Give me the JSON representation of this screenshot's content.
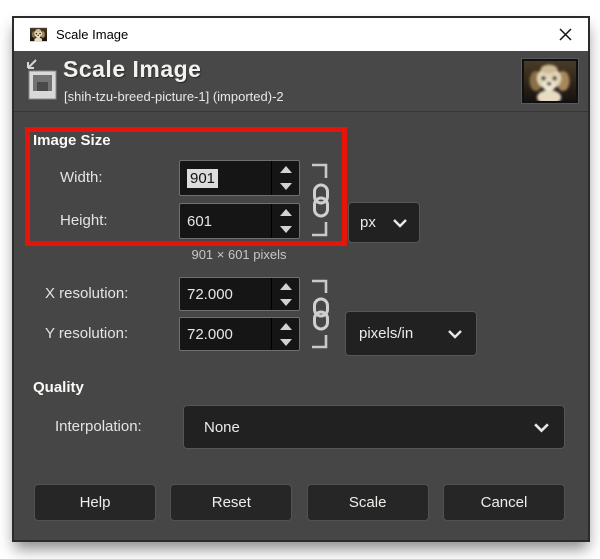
{
  "titlebar": {
    "title": "Scale Image"
  },
  "header": {
    "title": "Scale Image",
    "subtitle": "[shih-tzu-breed-picture-1] (imported)-2"
  },
  "image_size": {
    "heading": "Image Size",
    "width_label": "Width:",
    "width_value": "901",
    "height_label": "Height:",
    "height_value": "601",
    "unit_selected": "px",
    "pixel_note": "901 × 601 pixels"
  },
  "resolution": {
    "x_label": "X resolution:",
    "x_value": "72.000",
    "y_label": "Y resolution:",
    "y_value": "72.000",
    "unit_selected": "pixels/in"
  },
  "quality": {
    "heading": "Quality",
    "interpolation_label": "Interpolation:",
    "interpolation_selected": "None"
  },
  "buttons": [
    {
      "id": "help",
      "label": "Help"
    },
    {
      "id": "reset",
      "label": "Reset"
    },
    {
      "id": "scale",
      "label": "Scale"
    },
    {
      "id": "cancel",
      "label": "Cancel"
    }
  ],
  "icons": {
    "titlebar_icon": "dog-thumbnail-icon",
    "header_icon": "scale-image-icon",
    "link_icons": "chain-link-icon",
    "dropdown_icons": "chevron-down-icon",
    "close": "close-icon"
  },
  "colors": {
    "annotation_red": "#e81309",
    "dialog_bg": "#464646",
    "titlebar_bg": "#ffffff",
    "field_bg": "#151515",
    "selection_bg": "#dcdcdc",
    "button_bg": "#262626"
  }
}
